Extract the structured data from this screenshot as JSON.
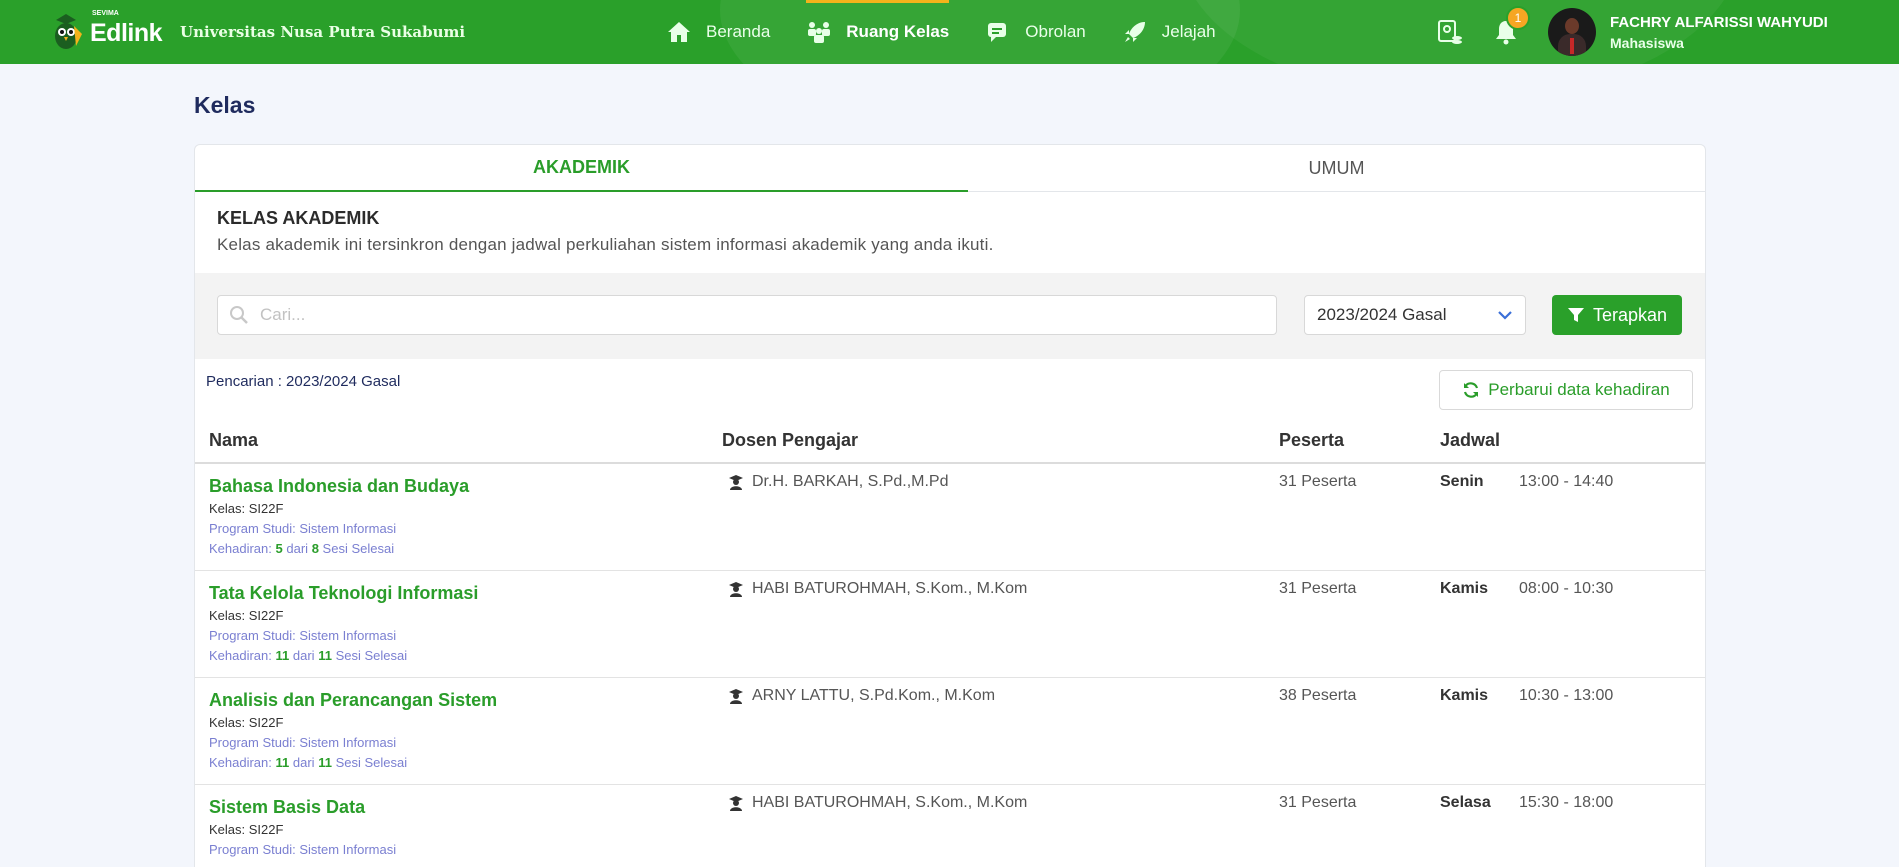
{
  "navbar": {
    "brand": "Edlink",
    "brand_sub": "SEVIMA",
    "university": "Universitas Nusa Putra Sukabumi",
    "menu": [
      {
        "label": "Beranda",
        "icon": "home-icon"
      },
      {
        "label": "Ruang Kelas",
        "icon": "classroom-icon",
        "active": true
      },
      {
        "label": "Obrolan",
        "icon": "chat-icon"
      },
      {
        "label": "Jelajah",
        "icon": "rocket-icon"
      }
    ],
    "notification_count": "1",
    "user": {
      "name": "FACHRY ALFARISSI WAHYUDI",
      "role": "Mahasiswa"
    },
    "colors": {
      "primary": "#2aa02a",
      "accent": "#f3b31b",
      "badge": "#f6a623"
    }
  },
  "page": {
    "title": "Kelas"
  },
  "tabs": [
    {
      "label": "AKADEMIK",
      "active": true
    },
    {
      "label": "UMUM",
      "active": false
    }
  ],
  "section": {
    "title": "KELAS AKADEMIK",
    "description": "Kelas akademik ini tersinkron dengan jadwal perkuliahan sistem informasi akademik yang anda ikuti."
  },
  "filter": {
    "search_placeholder": "Cari...",
    "search_value": "",
    "semester": "2023/2024 Gasal",
    "apply_label": "Terapkan"
  },
  "result": {
    "search_label": "Pencarian : 2023/2024 Gasal",
    "refresh_label": "Perbarui data kehadiran"
  },
  "table": {
    "headers": {
      "nama": "Nama",
      "dosen": "Dosen Pengajar",
      "peserta": "Peserta",
      "jadwal": "Jadwal"
    },
    "labels": {
      "kelas": "Kelas:",
      "program": "Program Studi:",
      "kehadiran": "Kehadiran:",
      "dari": "dari",
      "sesi": "Sesi Selesai"
    },
    "rows": [
      {
        "name": "Bahasa Indonesia dan Budaya",
        "kelas": "SI22F",
        "program": "Sistem Informasi",
        "hadir": "5",
        "total": "8",
        "dosen": "Dr.H. BARKAH, S.Pd.,M.Pd",
        "peserta": "31 Peserta",
        "day": "Senin",
        "time": "13:00 - 14:40"
      },
      {
        "name": "Tata Kelola Teknologi Informasi",
        "kelas": "SI22F",
        "program": "Sistem Informasi",
        "hadir": "11",
        "total": "11",
        "dosen": "HABI BATUROHMAH, S.Kom., M.Kom",
        "peserta": "31 Peserta",
        "day": "Kamis",
        "time": "08:00 - 10:30"
      },
      {
        "name": "Analisis dan Perancangan Sistem",
        "kelas": "SI22F",
        "program": "Sistem Informasi",
        "hadir": "11",
        "total": "11",
        "dosen": "ARNY LATTU, S.Pd.Kom., M.Kom",
        "peserta": "38 Peserta",
        "day": "Kamis",
        "time": "10:30 - 13:00"
      },
      {
        "name": "Sistem Basis Data",
        "kelas": "SI22F",
        "program": "Sistem Informasi",
        "hadir": "",
        "total": "",
        "dosen": "HABI BATUROHMAH, S.Kom., M.Kom",
        "peserta": "31 Peserta",
        "day": "Selasa",
        "time": "15:30 - 18:00"
      }
    ]
  }
}
